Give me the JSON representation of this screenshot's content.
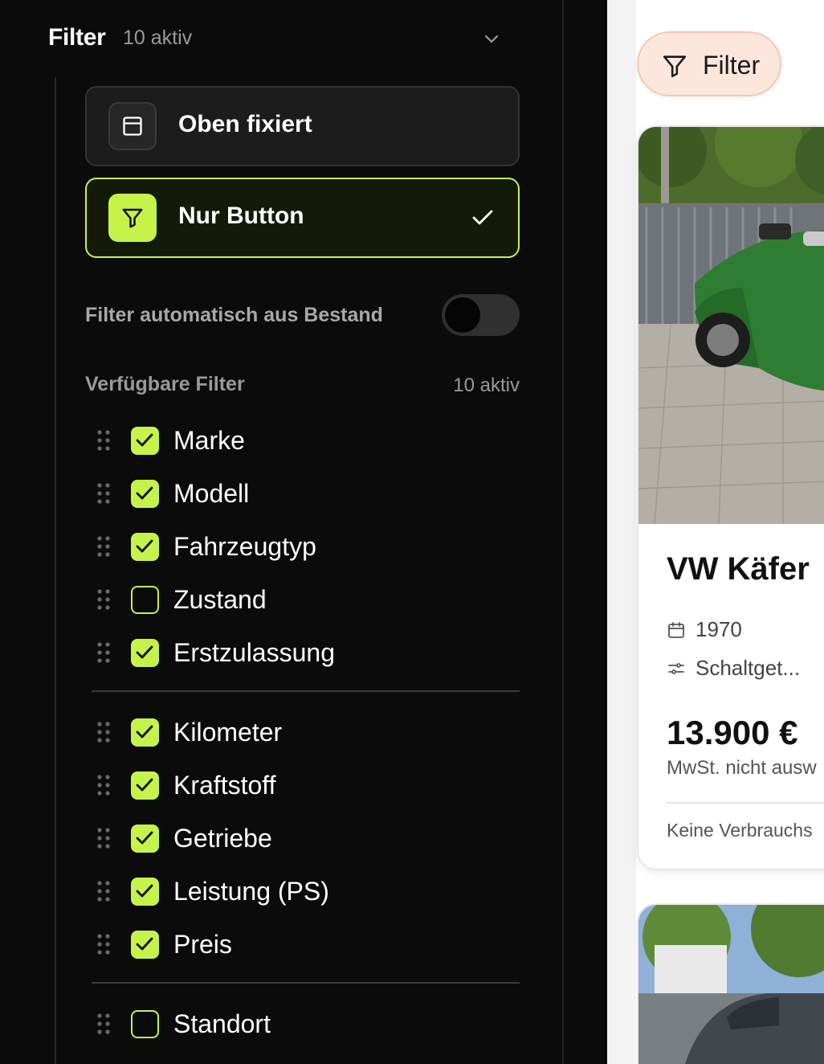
{
  "panel": {
    "title": "Filter",
    "active_count": "10 aktiv"
  },
  "modes": [
    {
      "label": "Oben fixiert",
      "icon": "layout-top-icon",
      "selected": false
    },
    {
      "label": "Nur Button",
      "icon": "funnel-icon",
      "selected": true
    }
  ],
  "auto_filter": {
    "label": "Filter automatisch aus Bestand",
    "enabled": false
  },
  "available_filters": {
    "title": "Verfügbare Filter",
    "count": "10 aktiv",
    "groups": [
      [
        {
          "label": "Marke",
          "checked": true
        },
        {
          "label": "Modell",
          "checked": true
        },
        {
          "label": "Fahrzeugtyp",
          "checked": true
        },
        {
          "label": "Zustand",
          "checked": false
        },
        {
          "label": "Erstzulassung",
          "checked": true
        }
      ],
      [
        {
          "label": "Kilometer",
          "checked": true
        },
        {
          "label": "Kraftstoff",
          "checked": true
        },
        {
          "label": "Getriebe",
          "checked": true
        },
        {
          "label": "Leistung (PS)",
          "checked": true
        },
        {
          "label": "Preis",
          "checked": true
        }
      ],
      [
        {
          "label": "Standort",
          "checked": false
        }
      ]
    ]
  },
  "preview": {
    "filter_button_label": "Filter",
    "card": {
      "title": "VW Käfer",
      "year": "1970",
      "transmission": "Schaltget...",
      "price": "13.900 €",
      "vat_note": "MwSt. nicht ausw",
      "consumption_note": "Keine Verbrauchs"
    }
  },
  "colors": {
    "accent": "#c6f34a",
    "panel_bg": "#0b0b0b",
    "pill_bg": "#fde7dd"
  }
}
